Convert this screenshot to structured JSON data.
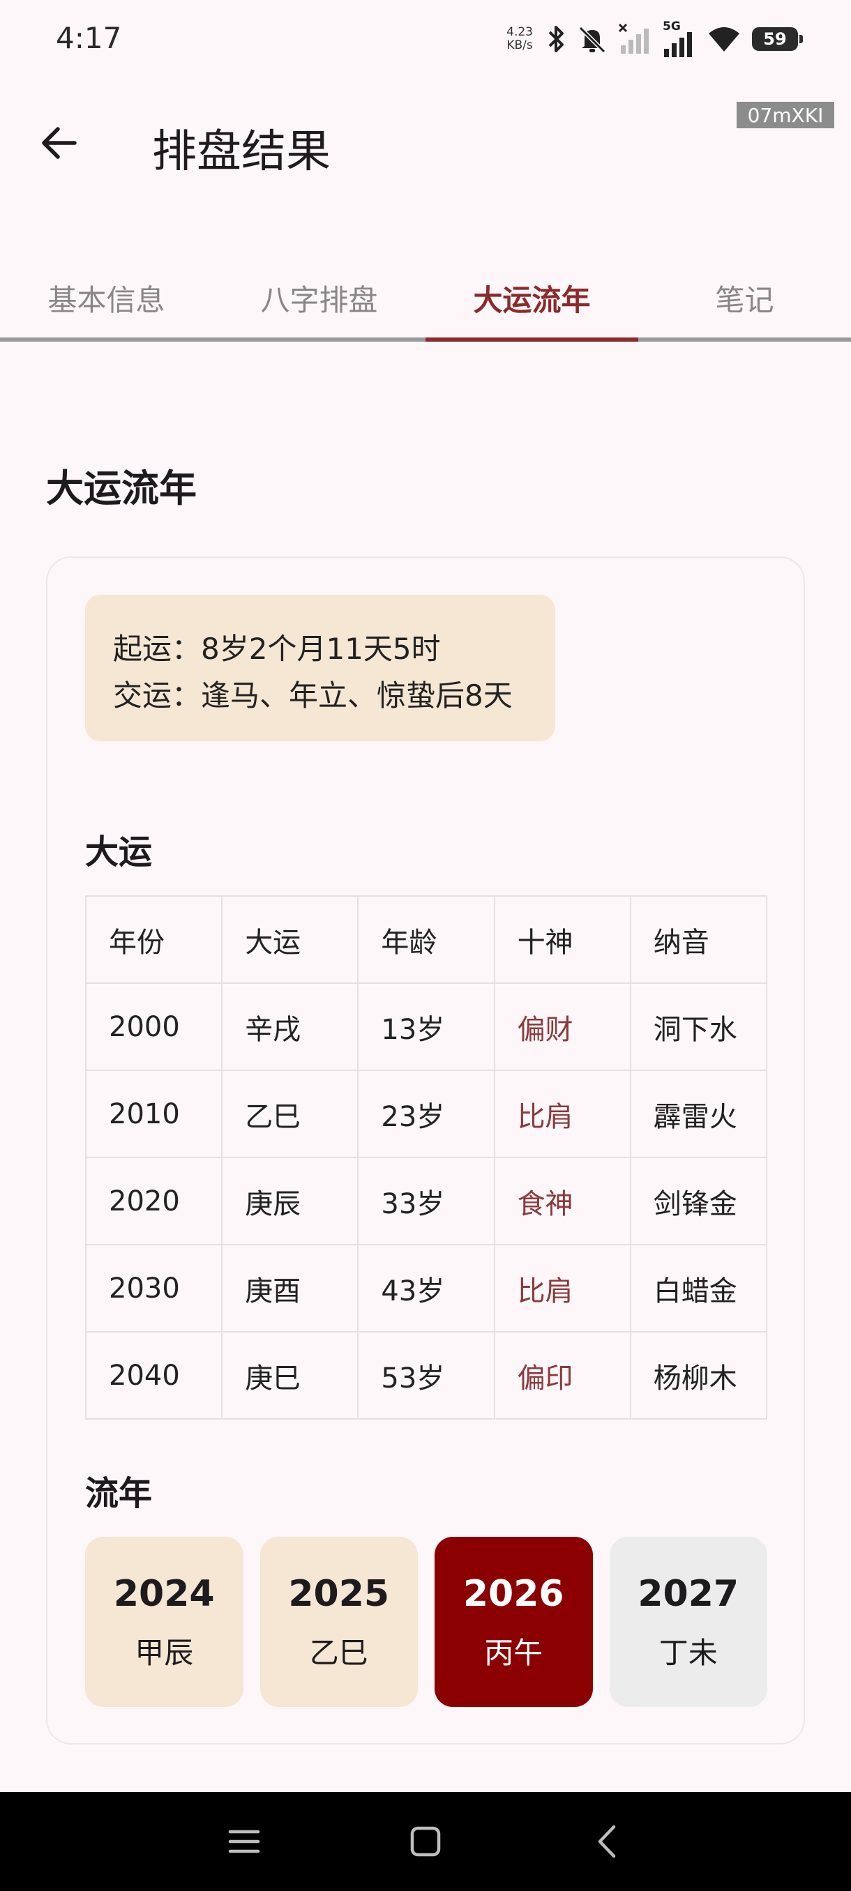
{
  "status_bar": {
    "time": "4:17",
    "net_speed_value": "4.23",
    "net_speed_unit": "KB/s",
    "signal_label": "5G",
    "battery": "59"
  },
  "app_bar": {
    "title": "排盘结果",
    "watermark": "07mXKI"
  },
  "tabs": [
    {
      "label": "基本信息",
      "active": false
    },
    {
      "label": "八字排盘",
      "active": false
    },
    {
      "label": "大运流年",
      "active": true
    },
    {
      "label": "笔记",
      "active": false
    }
  ],
  "section_title": "大运流年",
  "info": {
    "qiyun": "起运：8岁2个月11天5时",
    "jiaoyun": "交运：逢马、年立、惊蛰后8天"
  },
  "dayun": {
    "title": "大运",
    "headers": [
      "年份",
      "大运",
      "年龄",
      "十神",
      "纳音"
    ],
    "rows": [
      [
        "2000",
        "辛戌",
        "13岁",
        "偏财",
        "洞下水"
      ],
      [
        "2010",
        "乙巳",
        "23岁",
        "比肩",
        "霹雷火"
      ],
      [
        "2020",
        "庚辰",
        "33岁",
        "食神",
        "剑锋金"
      ],
      [
        "2030",
        "庚酉",
        "43岁",
        "比肩",
        "白蜡金"
      ],
      [
        "2040",
        "庚巳",
        "53岁",
        "偏印",
        "杨柳木"
      ]
    ]
  },
  "liunian": {
    "title": "流年",
    "years": [
      {
        "year": "2024",
        "ganzhi": "甲辰",
        "state": "past"
      },
      {
        "year": "2025",
        "ganzhi": "乙巳",
        "state": "past"
      },
      {
        "year": "2026",
        "ganzhi": "丙午",
        "state": "selected"
      },
      {
        "year": "2027",
        "ganzhi": "丁未",
        "state": "future"
      }
    ]
  },
  "colors": {
    "accent": "#8b2a2a",
    "selected_year": "#8b0000",
    "info_bg": "#f6e6d4",
    "background": "#fdf7fa"
  }
}
